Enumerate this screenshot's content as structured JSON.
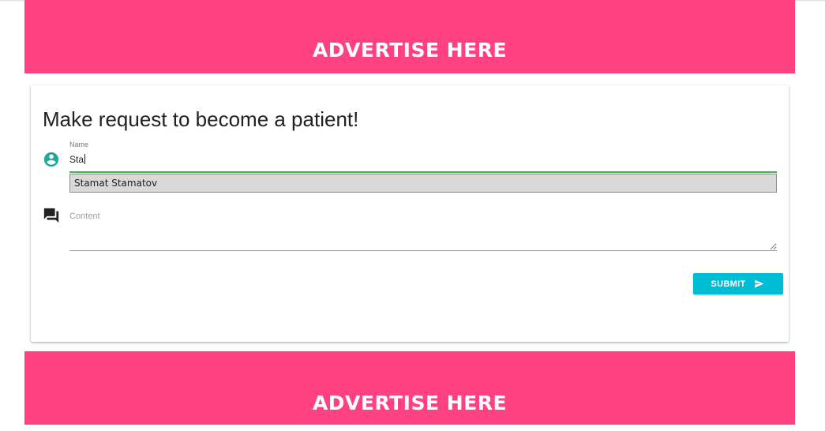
{
  "ads": {
    "top_text": "ADVERTISE HERE",
    "bottom_text": "ADVERTISE HERE",
    "color": "#ff4081"
  },
  "form": {
    "title": "Make request to become a patient!",
    "name": {
      "label": "Name",
      "value": "Sta",
      "icon": "account-circle-icon",
      "autocomplete_suggestion": "Stamat Stamatov"
    },
    "content": {
      "label": "Content",
      "value": "",
      "icon": "forum-icon"
    },
    "submit": {
      "label": "SUBMIT",
      "icon": "send-icon",
      "color": "#00bcd4"
    }
  },
  "colors": {
    "accent": "#00bcd4",
    "icon_teal": "#26a69a",
    "focus_underline": "#4caf50"
  }
}
